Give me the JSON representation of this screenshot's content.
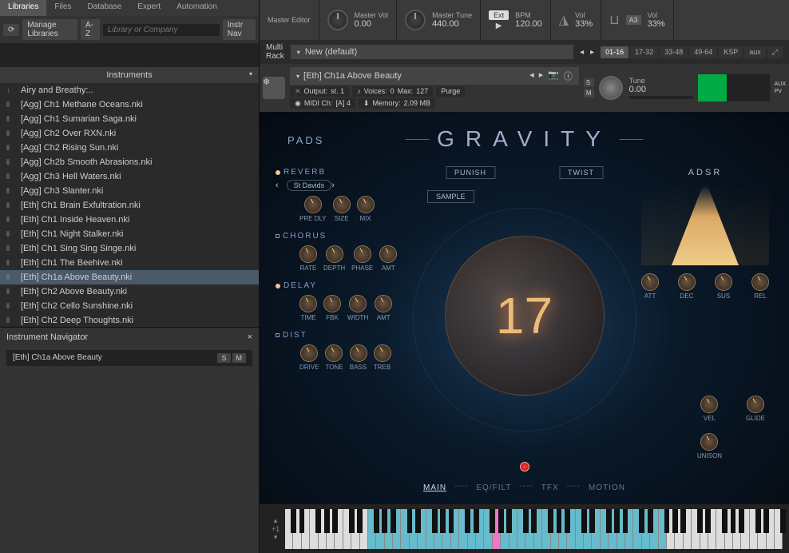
{
  "tabs": [
    "Libraries",
    "Files",
    "Database",
    "Expert",
    "Automation"
  ],
  "active_tab": 0,
  "toolbar": {
    "manage": "Manage Libraries",
    "sort": "A-Z",
    "search_placeholder": "Library or Company",
    "instr_nav": "Instr Nav"
  },
  "instruments_header": "Instruments",
  "instruments": [
    {
      "icon": "↑",
      "name": "Airy and Breathy:.."
    },
    {
      "icon": "⦀",
      "name": "[Agg] Ch1 Methane Oceans.nki"
    },
    {
      "icon": "⦀",
      "name": "[Agg] Ch1 Sumarian Saga.nki"
    },
    {
      "icon": "⦀",
      "name": "[Agg] Ch2 Over RXN.nki"
    },
    {
      "icon": "⦀",
      "name": "[Agg] Ch2 Rising Sun.nki"
    },
    {
      "icon": "⦀",
      "name": "[Agg] Ch2b Smooth Abrasions.nki"
    },
    {
      "icon": "⦀",
      "name": "[Agg] Ch3 Hell Waters.nki"
    },
    {
      "icon": "⦀",
      "name": "[Agg] Ch3 Slanter.nki"
    },
    {
      "icon": "⦀",
      "name": "[Eth] Ch1 Brain Exfultration.nki"
    },
    {
      "icon": "⦀",
      "name": "[Eth] Ch1 Inside Heaven.nki"
    },
    {
      "icon": "⦀",
      "name": "[Eth] Ch1 Night Stalker.nki"
    },
    {
      "icon": "⦀",
      "name": "[Eth] Ch1 Sing Sing Singe.nki"
    },
    {
      "icon": "⦀",
      "name": "[Eth] Ch1 The Beehive.nki"
    },
    {
      "icon": "⦀",
      "name": "[Eth] Ch1a Above Beauty.nki",
      "selected": true
    },
    {
      "icon": "⦀",
      "name": "[Eth] Ch2 Above Beauty.nki"
    },
    {
      "icon": "⦀",
      "name": "[Eth] Ch2 Cello Sunshine.nki"
    },
    {
      "icon": "⦀",
      "name": "[Eth] Ch2 Deep Thoughts.nki"
    }
  ],
  "navigator": {
    "title": "Instrument Navigator",
    "item": "[Eth] Ch1a Above Beauty",
    "s": "S",
    "m": "M"
  },
  "top": {
    "master_editor": "Master Editor",
    "master_vol": "Master Vol",
    "master_vol_val": "0.00",
    "master_tune": "Master Tune",
    "master_tune_val": "440.00",
    "ext": "Ext",
    "bpm": "BPM",
    "bpm_val": "120.00",
    "vol": "Vol",
    "vol_val": "33%",
    "vol2": "Vol",
    "vol2_val": "33%"
  },
  "rack": {
    "multi": "Multi",
    "rackl": "Rack",
    "preset": "New (default)",
    "pages": [
      "01-16",
      "17-32",
      "33-48",
      "49-64",
      "KSP",
      "aux"
    ]
  },
  "inst_header": {
    "title": "[Eth] Ch1a Above Beauty",
    "output": "Output:",
    "output_val": "st. 1",
    "midi": "MIDI Ch:",
    "midi_val": "[A] 4",
    "voices": "Voices:",
    "voices_val": "0",
    "max": "Max:",
    "max_val": "127",
    "memory": "Memory:",
    "memory_val": "2.09 MB",
    "purge": "Purge",
    "tune": "Tune",
    "tune_val": "0.00",
    "s": "S",
    "m": "M",
    "aux": "AUX",
    "pv": "PV"
  },
  "gravity": {
    "title": "GRAVITY",
    "pads": "PADS",
    "punish": "PUNISH",
    "twist": "TWIST",
    "sample": "SAMPLE",
    "number": "17",
    "fx": {
      "reverb": {
        "label": "REVERB",
        "preset": "St Davids",
        "knobs": [
          "PRE DLY",
          "SIZE",
          "MIX"
        ]
      },
      "chorus": {
        "label": "CHORUS",
        "knobs": [
          "RATE",
          "DEPTH",
          "PHASE",
          "AMT"
        ]
      },
      "delay": {
        "label": "DELAY",
        "knobs": [
          "TIME",
          "FBK",
          "WIDTH",
          "AMT"
        ]
      },
      "dist": {
        "label": "DIST",
        "knobs": [
          "DRIVE",
          "TONE",
          "BASS",
          "TREB"
        ]
      }
    },
    "adsr": {
      "label": "ADSR",
      "knobs": [
        "ATT",
        "DEC",
        "SUS",
        "REL"
      ]
    },
    "right_knobs": [
      "VEL",
      "GLIDE",
      "UNISON"
    ],
    "bottom_tabs": [
      "MAIN",
      "EQ/FILT",
      "TFX",
      "MOTION"
    ]
  },
  "keyboard": {
    "oct": "+1"
  }
}
